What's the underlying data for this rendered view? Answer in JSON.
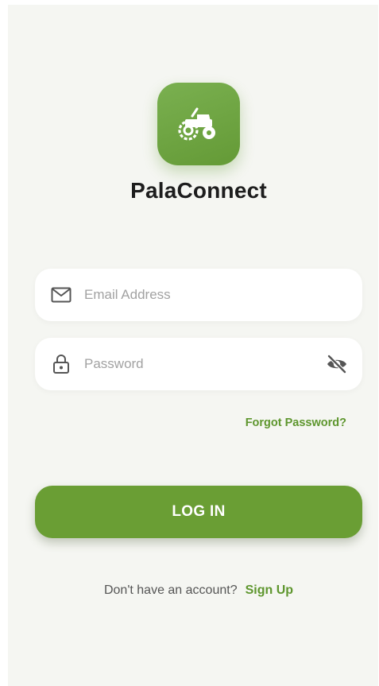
{
  "app": {
    "name": "PalaConnect",
    "logo_icon": "tractor-icon"
  },
  "colors": {
    "brand": "#6a9e34",
    "background": "#f5f6f2",
    "link": "#5e962e"
  },
  "email_field": {
    "icon": "mail-icon",
    "placeholder": "Email Address",
    "value": ""
  },
  "password_field": {
    "icon": "lock-icon",
    "placeholder": "Password",
    "value": "",
    "toggle_icon": "eye-off-icon"
  },
  "forgot_password": {
    "label": "Forgot Password?"
  },
  "login_button": {
    "label": "LOG IN"
  },
  "signup": {
    "prompt": "Don't have an account?",
    "link_label": "Sign Up"
  }
}
